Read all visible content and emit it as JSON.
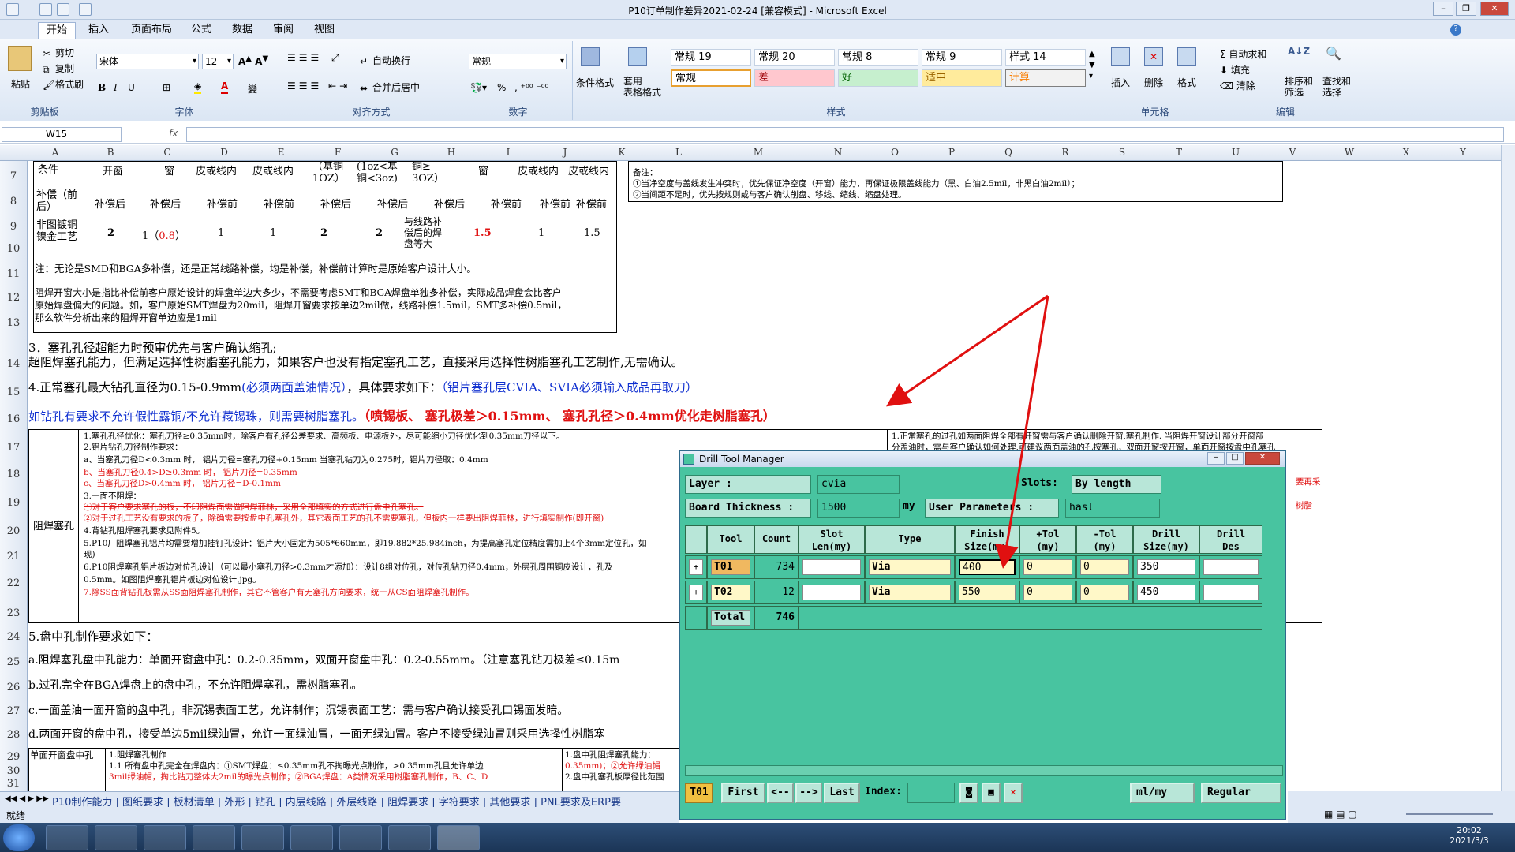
{
  "window": {
    "title": "P10订单制作差异2021-02-24 [兼容模式] - Microsoft Excel"
  },
  "tabs": [
    "开始",
    "插入",
    "页面布局",
    "公式",
    "数据",
    "审阅",
    "视图"
  ],
  "ribbon": {
    "clipboard": {
      "paste": "粘贴",
      "cut": "剪切",
      "copy": "复制",
      "format_painter": "格式刷",
      "label": "剪贴板"
    },
    "font": {
      "name": "宋体",
      "size": "12",
      "label": "字体"
    },
    "align": {
      "wrap": "自动换行",
      "merge": "合并后居中",
      "label": "对齐方式"
    },
    "number": {
      "format": "常规",
      "percent": "%",
      "label": "数字"
    },
    "styles": {
      "cond": "条件格式",
      "table": "套用\n表格格式",
      "cells": [
        "常规 19",
        "常规 20",
        "常规 8",
        "常规 9",
        "样式 14"
      ],
      "cells2": [
        "常规",
        "差",
        "好",
        "适中",
        "计算"
      ],
      "label": "样式"
    },
    "cellsgrp": {
      "insert": "插入",
      "delete": "删除",
      "format": "格式",
      "label": "单元格"
    },
    "edit": {
      "autosum": "自动求和",
      "fill": "填充",
      "clear": "清除",
      "sort": "排序和\n筛选",
      "find": "查找和\n选择",
      "label": "编辑"
    }
  },
  "formula": {
    "namebox": "W15",
    "fx": "fx"
  },
  "columns": [
    "A",
    "B",
    "C",
    "D",
    "E",
    "F",
    "G",
    "H",
    "I",
    "J",
    "K",
    "L",
    "M",
    "N",
    "O",
    "P",
    "Q",
    "R",
    "S",
    "T",
    "U",
    "V",
    "W",
    "X",
    "Y"
  ],
  "rows": [
    "7",
    "8",
    "9",
    "10",
    "11",
    "12",
    "13",
    "14",
    "15",
    "16",
    "17",
    "18",
    "19",
    "20",
    "21",
    "22",
    "23",
    "24",
    "25",
    "26",
    "27",
    "28",
    "29",
    "30",
    "31"
  ],
  "sheet": {
    "r7": [
      "条件",
      "开窗",
      "窗",
      "皮或线内",
      "皮或线内",
      "（基铜\n1OZ）",
      "(1oz<基\n铜<3oz)",
      "铜≥\n3OZ）",
      "窗",
      "皮或线内",
      "皮或线内"
    ],
    "r8": [
      "补偿（前\n后）",
      "补偿后",
      "补偿后",
      "补偿前",
      "补偿前",
      "补偿后",
      "补偿后",
      "补偿后",
      "补偿前",
      "补偿前",
      "补偿前"
    ],
    "r9": [
      "非图镀铜\n镍金工艺",
      "2",
      "1（",
      "0.8",
      "）",
      "1",
      "1",
      "2",
      "2",
      "与线路补\n偿后的焊\n盘等大",
      "1.5",
      "1",
      "1.5"
    ],
    "note_r": "备注：",
    "note1": "①当净空度与盖线发生冲突时，优先保证净空度（开窗）能力，再保证极限盖线能力（黑、白油2.5mil，非黑白油2mil）；",
    "note2": "②当间距不足时，优先按规则或与客户确认削盘、移线、缩线、缩盘处理。",
    "r10": "注：无论是SMD和BGA多补偿，还是正常线路补偿，均是补偿，补偿前计算时是原始客户设计大小。",
    "r11a": "阻焊开窗大小是指比补偿前客户原始设计的焊盘单边大多少，不需要考虑SMT和BGA焊盘单独多补偿，实际成品焊盘会比客户",
    "r11b": "原始焊盘偏大的问题。如，客户原始SMT焊盘为20mil，阻焊开窗要求按单边2mil做，线路补偿1.5mil，SMT多补偿0.5mil，",
    "r11c": "那么软件分析出来的阻焊开窗单边应是1mil",
    "r13": "3．塞孔孔径超能力时预审优先与客户确认缩孔;",
    "r14": "超阻焊塞孔能力，但满足选择性树脂塞孔能力，如果客户也没有指定塞孔工艺，直接采用选择性树脂塞孔工艺制作,无需确认。",
    "r15a": "4.正常塞孔最大钻孔直径为0.15-0.9mm",
    "r15b": "(必须两面盖油情况）",
    "r15c": "，具体要求如下：",
    "r15d": "（铝片塞孔层CVIA、SVIA必须输入成品再取刀）",
    "r16a": "如钻孔有要求不允许假性露铜/不允许藏锡珠，则需要树脂塞孔。",
    "r16b": "（喷锡板、    塞孔极差＞0.15mm、    塞孔孔径＞0.4mm优化走树脂塞孔）",
    "a_r17": "阻焊塞孔",
    "b17": [
      "1.塞孔孔径优化：塞孔刀径≥0.35mm时，除客户有孔径公差要求、高频板、电源板外，尽可能缩小刀径优化到0.35mm刀径以下。",
      "2.铝片钻孔刀径制作要求：",
      "a、当塞孔刀径D<0.3mm 时， 铝片刀径=塞孔刀径+0.15mm     当塞孔钻刀为0.275时，铝片刀径取：0.4mm",
      "b、当塞孔刀径0.4>D≥0.3mm 时， 铝片刀径=0.35mm",
      "c、当塞孔刀径D>0.4mm 时， 铝片刀径=D-0.1mm",
      "3.一面不阻焊：",
      "①对于客户要求塞孔的板，不印阻焊面需做阻焊菲林，采用全部填实的方式进行盘中孔塞孔。",
      "②对于过孔工艺没有要求的板子，除确需要按盘中孔塞孔外，其它表面工艺的孔不需要塞孔，但板内一样要出阻焊菲林，进行填实制作(即开窗)",
      "4.背钻孔阻焊塞孔要求见附件5。",
      "5.P10厂阻焊塞孔铝片均需要增加挂钉孔设计：铝片大小固定为505*660mm，即19.882*25.984inch，为提高塞孔定位精度需加上4个3mm定位孔，如",
      "现)",
      "6.P10阻焊塞孔铝片板边对位孔设计（可以最小塞孔刀径>0.3mm才添加）：设计8组对位孔，对位孔钻刀径0.4mm，外层孔周围铜皮设计，孔及",
      "0.5mm。如图阻焊塞孔铝片板边对位设计.jpg。",
      "7.除SS面背钻孔板需从SS面阻焊塞孔制作，其它不管客户有无塞孔方向要求，统一从CS面阻焊塞孔制作。"
    ],
    "right_note": [
      "1.正常塞孔的过孔如两面阻焊全部有开窗需与客户确认删除开窗,塞孔制作. 当阻焊开窗设计部分开窗部",
      "分盖油时，需与客户确认如何处理,可建议两面盖油的孔按塞孔，双面开窗按开窗，单面开窗按盘中孔塞孔",
      "要再采",
      "树脂"
    ],
    "r24": "5.盘中孔制作要求如下：",
    "r25": "a.阻焊塞孔盘中孔能力：单面开窗盘中孔：0.2-0.35mm，双面开窗盘中孔：0.2-0.55mm。（注意塞孔钻刀极差≤0.15m",
    "r26": "b.过孔完全在BGA焊盘上的盘中孔，不允许阻焊塞孔，需树脂塞孔。",
    "r27": "c.一面盖油一面开窗的盘中孔，非沉锡表面工艺，允许制作；沉锡表面工艺：需与客户确认接受孔口锡面发暗。",
    "r28": "d.两面开窗的盘中孔，接受单边5mil绿油冒，允许一面绿油冒，一面无绿油冒。客户不接受绿油冒则采用选择性树脂塞",
    "r29a": "单面开窗盘中孔",
    "r29b": [
      "1.阻焊塞孔制作",
      "1.1  所有盘中孔完全在焊盘内：①SMT焊盘：≤0.35mm孔不掏曝光点制作，>0.35mm孔且允许单边",
      "3mil绿油帽，掏比钻刀整体大2mil的曝光点制作；②BGA焊盘：A类情况采用树脂塞孔制作，B、C、D"
    ],
    "r29c": [
      "1.盘中孔阻焊塞孔能力：",
      "0.35mm)；②允许绿油帽",
      "2.盘中孔塞孔板厚径比范围"
    ]
  },
  "sheettabs": [
    "P10制作能力",
    "图纸要求",
    "板材清单",
    "外形",
    "钻孔",
    "内层线路",
    "外层线路",
    "阻焊要求",
    "字符要求",
    "其他要求",
    "PNL要求及ERP要"
  ],
  "status": "就绪",
  "dialog": {
    "title": "Drill Tool Manager",
    "layer_label": "Layer          :",
    "layer": "cvia",
    "slots_label": "Slots:",
    "slots": "By length",
    "thick_label": "Board Thickness :",
    "thick": "1500",
    "thick_unit": "my",
    "user_label": "User Parameters :",
    "user": "hasl",
    "headers": [
      "Tool",
      "Count",
      "Slot\nLen(my)",
      "Type",
      "Finish\nSize(my)",
      "+Tol\n(my)",
      "-Tol\n(my)",
      "Drill\nSize(my)",
      "Drill\nDes"
    ],
    "rows": [
      {
        "tool": "T01",
        "count": "734",
        "type": "Via",
        "finish": "400",
        "ptol": "0",
        "mtol": "0",
        "drill": "350"
      },
      {
        "tool": "T02",
        "count": "12",
        "type": "Via",
        "finish": "550",
        "ptol": "0",
        "mtol": "0",
        "drill": "450"
      }
    ],
    "total_label": "Total",
    "total": "746",
    "footer": {
      "cur": "T01",
      "first": "First",
      "prev": "<--",
      "next": "-->",
      "last": "Last",
      "index": "Index:",
      "unit": "ml/my",
      "mode": "Regular"
    }
  },
  "taskbar": {
    "time": "20:02",
    "date": "2021/3/3"
  },
  "colors": {
    "dialog_bg": "#48c4a0",
    "arrow": "#e01010"
  }
}
